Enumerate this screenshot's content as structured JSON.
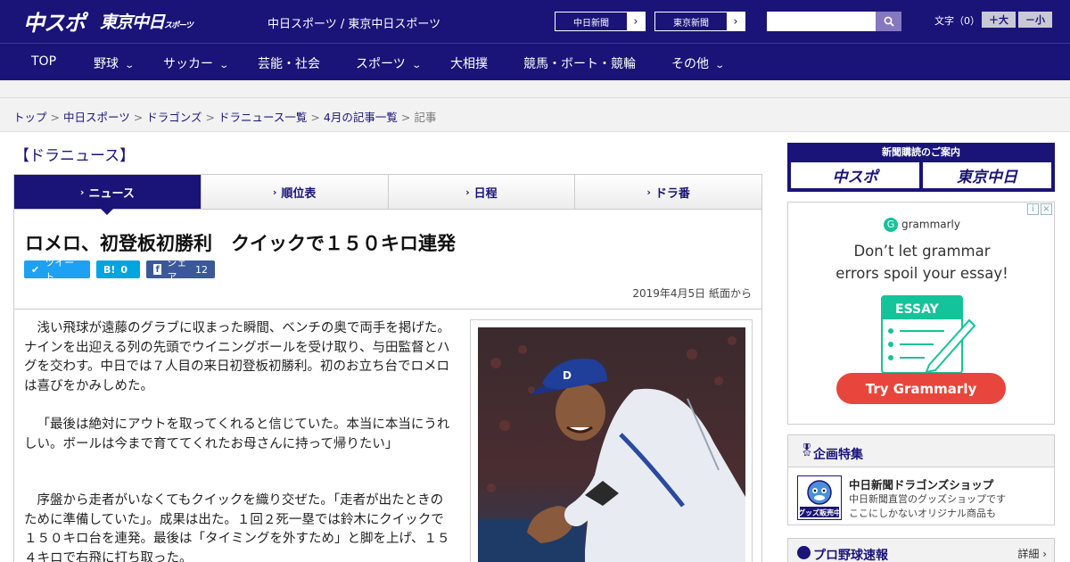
{
  "header": {
    "logo_chunichi_sports": "中スポ",
    "logo_tokyo_chunichi": "東京中日",
    "logo_tokyo_chunichi_sub": "スポーツ",
    "site_title": "中日スポーツ / 東京中日スポーツ",
    "link_chunichi": "中日新聞",
    "link_tokyo": "東京新聞",
    "font_size_label": "文字（0）",
    "font_bigger": "＋大",
    "font_smaller": "－小"
  },
  "nav": {
    "items": [
      {
        "label": "TOP",
        "has_menu": false
      },
      {
        "label": "野球",
        "has_menu": true
      },
      {
        "label": "サッカー",
        "has_menu": true
      },
      {
        "label": "芸能・社会",
        "has_menu": false
      },
      {
        "label": "スポーツ",
        "has_menu": true
      },
      {
        "label": "大相撲",
        "has_menu": false
      },
      {
        "label": "競馬・ボート・競輪",
        "has_menu": false
      },
      {
        "label": "その他",
        "has_menu": true
      }
    ]
  },
  "breadcrumb": {
    "items": [
      "トップ",
      "中日スポーツ",
      "ドラゴンズ",
      "ドラニュース一覧",
      "4月の記事一覧"
    ],
    "separator": ">",
    "current": "記事"
  },
  "section_title": "【ドラニュース】",
  "tabs": [
    {
      "label": "ニュース",
      "active": true
    },
    {
      "label": "順位表",
      "active": false
    },
    {
      "label": "日程",
      "active": false
    },
    {
      "label": "ドラ番",
      "active": false
    }
  ],
  "article": {
    "headline": "ロメロ、初登板初勝利　クイックで１５０キロ連発",
    "share": {
      "tweet_label": "ツイート",
      "hatena_icon": "B!",
      "hatena_count": "0",
      "facebook_label": "シェア",
      "facebook_count": "12"
    },
    "date": "2019年4月5日 紙面から",
    "paragraphs": [
      "浅い飛球が遠藤のグラブに収まった瞬間、ベンチの奥で両手を掲げた。ナインを出迎える列の先頭でウイニングボールを受け取り、与田監督とハグを交わす。中日では７人目の来日初登板初勝利。初のお立ち台でロメロは喜びをかみしめた。",
      "「最後は絶対にアウトを取ってくれると信じていた。本当に本当にうれしい。ボールは今まで育ててくれたお母さんに持って帰りたい」",
      "序盤から走者がいなくてもクイックを織り交ぜた。「走者が出たときのために準備していた」。成果は出た。１回２死一塁では鈴木にクイックで１５０キロ台を連発。最後は「タイミングを外すため」と脚を上げ、１５４キロで右飛に打ち取った。"
    ]
  },
  "sidebar": {
    "subscribe_title": "新聞購読のご案内",
    "subscribe_chusupo": "中スポ",
    "subscribe_tokyo": "東京中日",
    "ad": {
      "brand": "grammarly",
      "headline_line1": "Don’t let grammar",
      "headline_line2": "errors spoil your essay!",
      "essay_label": "ESSAY",
      "cta": "Try Grammarly"
    },
    "feature": {
      "title": "企画特集",
      "shop_title": "中日新聞ドラゴンズショップ",
      "shop_desc1": "中日新聞直営のグッズショップです",
      "shop_desc2": "ここにしかないオリジナル商品も",
      "shop_badge": "グッズ販売中"
    },
    "score": {
      "title": "プロ野球速報",
      "more": "詳細 ›"
    }
  },
  "colors": {
    "brand_navy": "#1a1478",
    "grammarly_red": "#e8453c",
    "grammarly_green": "#15c39a",
    "twitter": "#1da1f2",
    "hatena": "#00a4de",
    "facebook": "#3b5998"
  }
}
